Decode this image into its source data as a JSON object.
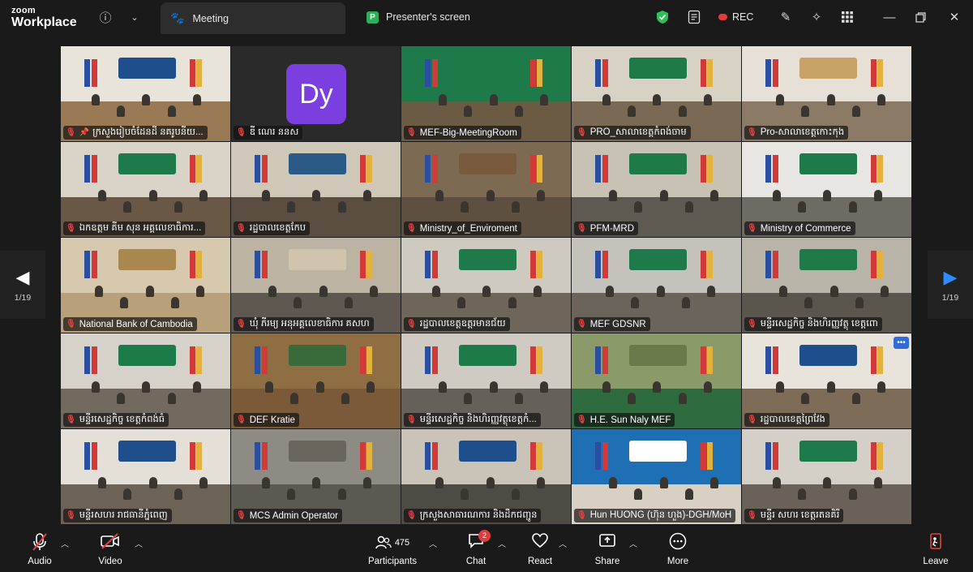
{
  "app": {
    "logo_top": "zoom",
    "logo_bottom": "Workplace"
  },
  "tabs": {
    "meeting": "Meeting",
    "presenter_badge": "P",
    "presenter": "Presenter's screen"
  },
  "titlebar": {
    "rec_label": "REC",
    "icons": [
      "info-icon",
      "chevron-down-icon",
      "shield-check-icon",
      "notes-icon",
      "record-icon",
      "annotate-icon",
      "ai-companion-icon",
      "apps-grid-icon",
      "minimize-icon",
      "restore-icon",
      "close-icon"
    ]
  },
  "pagination": {
    "left": "1/19",
    "right": "1/19"
  },
  "tiles": [
    {
      "name": "ក្រសួងរៀបចំដែនដី នគរូបនីយ...",
      "pinned": true
    },
    {
      "name": "ឌី ណេរ ននស",
      "avatar": "Dy"
    },
    {
      "name": "MEF-Big-MeetingRoom",
      "active": true
    },
    {
      "name": "PRO_សាលាខេត្តកំពង់ចាម"
    },
    {
      "name": "Pro-សាលាខេត្តកោះកុង"
    },
    {
      "name": "ឯកឧត្តម គីម សុន អគ្គលេខាធិការ..."
    },
    {
      "name": "រដ្ឋបាលខេត្តកែប"
    },
    {
      "name": "Ministry_of_Enviroment"
    },
    {
      "name": "PFM-MRD"
    },
    {
      "name": "Ministry of Commerce"
    },
    {
      "name": "National Bank of Cambodia"
    },
    {
      "name": "ឃុំ ភីរម្យ អនុអគ្គលេខាធិការ គសហ"
    },
    {
      "name": "រដ្ឋបាលខេត្តឧត្តរមានជ័យ"
    },
    {
      "name": "MEF GDSNR"
    },
    {
      "name": "មន្ទីរសេដ្ឋកិច្ច និងហិរញ្ញវត្ថុ ខេត្តពោ"
    },
    {
      "name": "មន្ទីរសេដ្ឋកិច្ច ខេត្តកំពង់ធំ"
    },
    {
      "name": "DEF Kratie"
    },
    {
      "name": "មន្ទីរសេដ្ឋកិច្ច និងហិរញ្ញវត្ថុខេត្តកំ..."
    },
    {
      "name": "H.E. Sun Naly MEF"
    },
    {
      "name": "រដ្ឋបាលខេត្តព្រៃវែង",
      "more": "•••"
    },
    {
      "name": "មន្ទីរសហរ រាជធានីភ្នំពេញ"
    },
    {
      "name": "MCS Admin Operator"
    },
    {
      "name": "ក្រសួងសាធារណការ និងដឹកជញ្ជូន"
    },
    {
      "name": "Hun HUONG (ហ៊ុន ហួង)-DGH/MoH"
    },
    {
      "name": "មន្ទីរ សហរ ខេត្តរតនគិរី"
    }
  ],
  "toolbar": {
    "audio": "Audio",
    "video": "Video",
    "participants": "Participants",
    "participants_count": "475",
    "chat": "Chat",
    "chat_badge": "2",
    "react": "React",
    "share": "Share",
    "more": "More",
    "leave": "Leave"
  },
  "colors": {
    "accent_green": "#39c56b",
    "mute_red": "#e84040",
    "avatar_purple": "#7b3fe0"
  }
}
